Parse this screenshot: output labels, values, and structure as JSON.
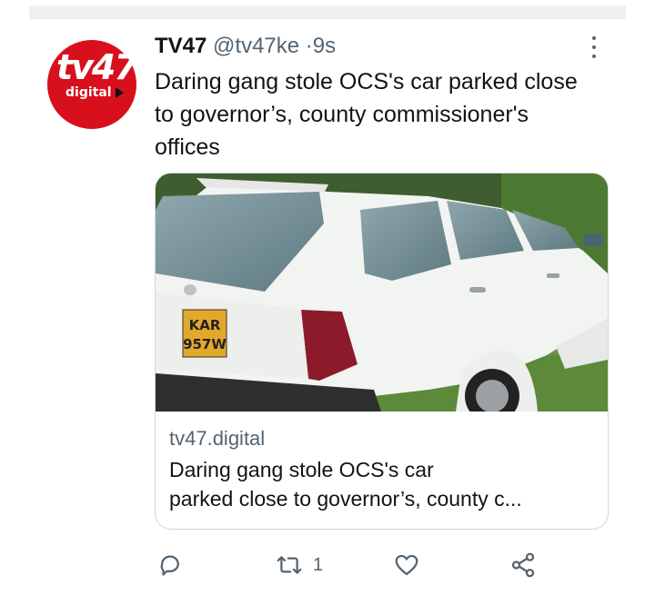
{
  "tweet": {
    "author_name": "TV47",
    "handle": "@tv47ke",
    "separator": "·",
    "time": "9s",
    "avatar_logo": "tv47",
    "avatar_subtitle": "digital",
    "text": "Daring gang stole OCS's car parked close to governor’s, county commissioner's offices"
  },
  "card": {
    "image_icon": "white-toyota-car-photo",
    "plate_line1": "KAR",
    "plate_line2": "957W",
    "domain": "tv47.digital",
    "title_line1": "Daring gang stole OCS's car",
    "title_line2": "parked close to governor’s, county c..."
  },
  "actions": {
    "reply_icon": "reply-icon",
    "retweet_icon": "retweet-icon",
    "retweet_count": "1",
    "like_icon": "heart-icon",
    "share_icon": "share-icon"
  },
  "colors": {
    "brand_red": "#d7101c",
    "text_primary": "#0f1419",
    "text_secondary": "#536471",
    "border": "#cfd9de"
  }
}
